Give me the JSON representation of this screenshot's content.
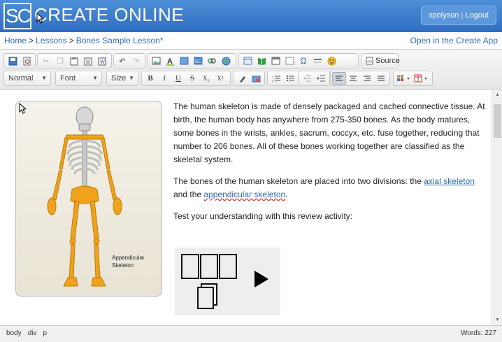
{
  "header": {
    "logo": "SC",
    "brand": "CREATE ONLINE",
    "user": "spolyson",
    "logout": "Logout"
  },
  "breadcrumb": {
    "items": [
      "Home",
      "Lessons",
      "Bones Sample Lesson*"
    ],
    "open_link": "Open in the Create App"
  },
  "toolbar": {
    "row1_icons": [
      "save-icon",
      "preview-icon",
      "cut-icon",
      "copy-icon",
      "paste-icon",
      "paste-text-icon",
      "paste-word-icon",
      "undo-icon",
      "redo-icon",
      "image-icon",
      "text-color-icon",
      "media-icon",
      "sc-icon",
      "link-icon",
      "web-icon",
      "table-icon",
      "book-icon",
      "grid-icon",
      "frame-icon",
      "omega-icon",
      "separator-icon",
      "smiley-icon"
    ],
    "source_label": "Source",
    "format_value": "Normal",
    "font_value": "Font",
    "size_value": "Size",
    "bold": "B",
    "italic": "I",
    "underline": "U",
    "strike": "S",
    "subscript": "X₂",
    "superscript": "X²"
  },
  "content": {
    "paragraph1": "The human skeleton is made of densely packaged and cached connective tissue. At birth, the human body has anywhere from 275-350 bones. As the body matures, some bones in the wrists, ankles, sacrum, coccyx, etc. fuse together, reducing that number to 206 bones. All of these bones working together are classified as the skeletal system.",
    "paragraph2_start": "The bones of the human skeleton are placed into two divisions: the ",
    "axial_link": "axial skeleton",
    "paragraph2_mid": " and the ",
    "appendicular_link": "appendicular skeleton",
    "paragraph2_end": ".",
    "paragraph3": "Test your understanding with this review activity:",
    "image_label_line1": "Appendicular",
    "image_label_line2": "Skeleton"
  },
  "status": {
    "path": [
      "body",
      "div",
      "p"
    ],
    "words": "Words: 227"
  },
  "colors": {
    "header": "#2f6ec2",
    "link": "#2f6db6",
    "bone": "#f0a21a"
  }
}
